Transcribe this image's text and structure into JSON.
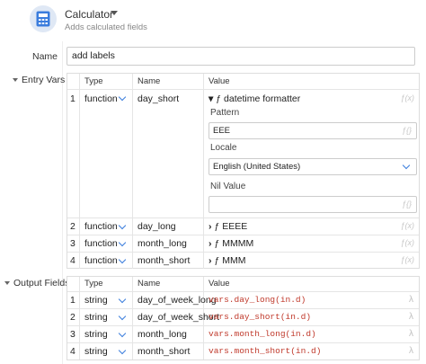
{
  "header": {
    "title": "Calculator",
    "subtitle": "Adds calculated fields",
    "icon": "calculator-icon"
  },
  "name": {
    "label": "Name",
    "value": "add labels"
  },
  "entry_vars": {
    "label": "Entry Vars",
    "columns": [
      "",
      "Type",
      "Name",
      "Value"
    ],
    "rows": [
      {
        "index": "1",
        "type": "function",
        "name": "day_short",
        "value": "ƒ datetime formatter"
      },
      {
        "index": "2",
        "type": "function",
        "name": "day_long",
        "value": "ƒ EEEE"
      },
      {
        "index": "3",
        "type": "function",
        "name": "month_long",
        "value": "ƒ MMMM"
      },
      {
        "index": "4",
        "type": "function",
        "name": "month_short",
        "value": "ƒ MMM"
      }
    ],
    "expanded": {
      "pattern_label": "Pattern",
      "pattern_value": "EEE",
      "locale_label": "Locale",
      "locale_value": "English (United States)",
      "nil_label": "Nil Value",
      "nil_value": ""
    }
  },
  "output_fields": {
    "label": "Output Fields",
    "columns": [
      "",
      "Type",
      "Name",
      "Value"
    ],
    "rows": [
      {
        "index": "1",
        "type": "string",
        "name": "day_of_week_long",
        "value": "vars.day_long(in.d)"
      },
      {
        "index": "2",
        "type": "string",
        "name": "day_of_week_short",
        "value": "vars.day_short(in.d)"
      },
      {
        "index": "3",
        "type": "string",
        "name": "month_long",
        "value": "vars.month_long(in.d)"
      },
      {
        "index": "4",
        "type": "string",
        "name": "month_short",
        "value": "vars.month_short(in.d)"
      }
    ]
  },
  "glyphs": {
    "fx": "ƒ(x)",
    "fx_braces": "ƒ{}",
    "lambda": "λ",
    "expanded": "▾",
    "collapsed": "›"
  },
  "colors": {
    "accent": "#3b7ddd",
    "code": "#c0392b",
    "icon_bg": "#dfe8f5"
  }
}
